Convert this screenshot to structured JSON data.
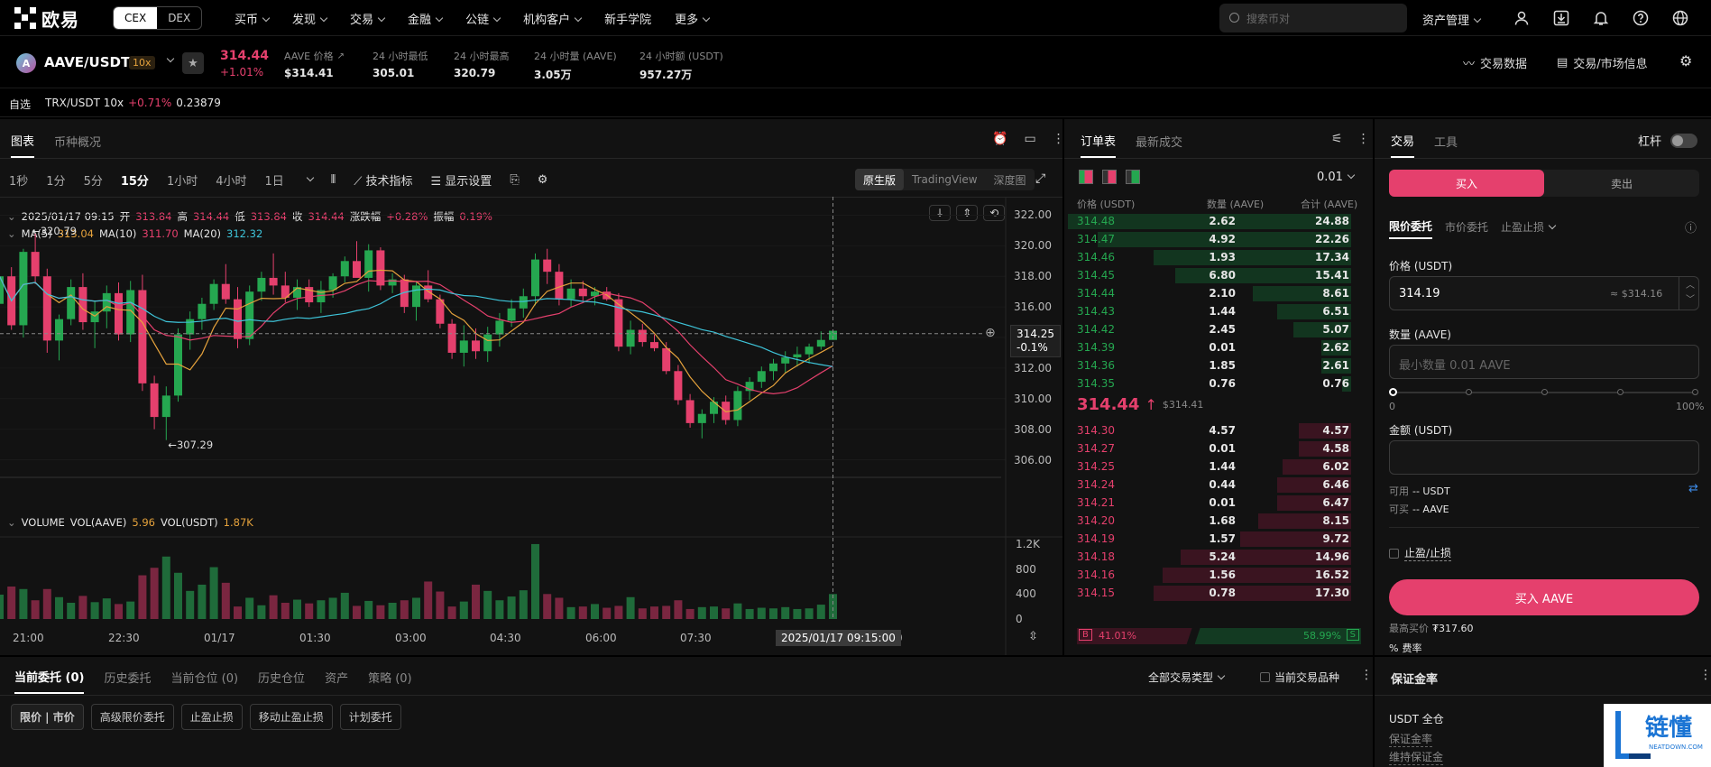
{
  "nav": {
    "brand": "欧易",
    "mode_cex": "CEX",
    "mode_dex": "DEX",
    "items": [
      "买币",
      "发现",
      "交易",
      "金融",
      "公链",
      "机构客户",
      "新手学院",
      "更多"
    ],
    "search_placeholder": "搜索币对",
    "asset_menu": "资产管理",
    "icons": [
      "user-icon",
      "download-icon",
      "bell-icon",
      "help-icon",
      "globe-icon"
    ]
  },
  "ticker": {
    "pair": "AAVE/USDT",
    "leverage": "10x",
    "price": "314.44",
    "change": "+1.01%",
    "stats": [
      {
        "label": "AAVE 价格",
        "value": "$314.41"
      },
      {
        "label": "24 小时最低",
        "value": "305.01"
      },
      {
        "label": "24 小时最高",
        "value": "320.79"
      },
      {
        "label": "24 小时量 (AAVE)",
        "value": "3.05万"
      },
      {
        "label": "24 小时额 (USDT)",
        "value": "957.27万"
      }
    ],
    "trade_data": "交易数据",
    "market_info": "交易/市场信息"
  },
  "watch": {
    "label": "自选",
    "item_pair": "TRX/USDT 10x",
    "item_change": "+0.71%",
    "item_price": "0.23879"
  },
  "chart": {
    "tab_chart": "图表",
    "tab_overview": "币种概况",
    "timeframes": [
      "1秒",
      "1分",
      "5分",
      "15分",
      "1小时",
      "4小时",
      "1日"
    ],
    "indicators": "技术指标",
    "display_settings": "显示设置",
    "modes": [
      "原生版",
      "TradingView",
      "深度图"
    ],
    "ohlc": {
      "date": "2025/01/17 09:15",
      "open_l": "开",
      "open": "313.84",
      "high_l": "高",
      "high": "314.44",
      "low_l": "低",
      "low": "313.84",
      "close_l": "收",
      "close": "314.44",
      "chg_l": "涨跌幅",
      "chg": "+0.28%",
      "amp_l": "振幅",
      "amp": "0.19%"
    },
    "ma": {
      "ma5_l": "MA(5)",
      "ma5": "313.04",
      "ma10_l": "MA(10)",
      "ma10": "311.70",
      "ma20_l": "MA(20)",
      "ma20": "312.32"
    },
    "vol": {
      "title": "VOLUME",
      "vol_aave_l": "VOL(AAVE)",
      "vol_aave": "5.96",
      "vol_usdt_l": "VOL(USDT)",
      "vol_usdt": "1.87K"
    },
    "y_ticks": [
      "322.00",
      "320.00",
      "318.00",
      "316.00",
      "314.00",
      "312.00",
      "310.00",
      "308.00",
      "306.00"
    ],
    "vol_ticks": [
      "1.2K",
      "800",
      "400",
      "0"
    ],
    "x_ticks": [
      "21:00",
      "22:30",
      "01/17",
      "01:30",
      "03:00",
      "04:30",
      "06:00",
      "07:30",
      "10:30"
    ],
    "cur_price": "314.25",
    "cur_pct": "-0.1%",
    "max_label": "320.79",
    "min_label": "307.29",
    "time_tag": "2025/01/17 09:15:00",
    "colors": {
      "up": "#25a750",
      "down": "#e5406d",
      "ma5": "#e5a23c",
      "ma10": "#e5406d",
      "ma20": "#3ec4d9"
    }
  },
  "chart_data": {
    "type": "candlestick",
    "y_range": [
      305.5,
      322.5
    ],
    "vol_range": [
      0,
      1300
    ],
    "candles": [
      [
        316.2,
        318.4,
        315.1,
        318.0
      ],
      [
        318.0,
        318.6,
        314.5,
        314.8
      ],
      [
        314.8,
        319.8,
        314.0,
        319.6
      ],
      [
        319.6,
        320.79,
        317.5,
        318.0
      ],
      [
        318.0,
        318.5,
        313.0,
        313.8
      ],
      [
        313.8,
        315.5,
        312.5,
        315.2
      ],
      [
        315.2,
        317.8,
        314.8,
        317.3
      ],
      [
        317.3,
        318.2,
        314.5,
        315.0
      ],
      [
        315.0,
        316.4,
        313.3,
        315.7
      ],
      [
        315.7,
        317.4,
        314.6,
        316.9
      ],
      [
        316.9,
        317.6,
        313.8,
        314.2
      ],
      [
        314.2,
        317.7,
        313.7,
        317.1
      ],
      [
        317.1,
        318.1,
        310.5,
        311.0
      ],
      [
        311.0,
        311.5,
        308.0,
        308.8
      ],
      [
        308.8,
        310.8,
        307.29,
        310.2
      ],
      [
        310.2,
        314.6,
        309.8,
        314.2
      ],
      [
        314.2,
        315.7,
        313.2,
        315.2
      ],
      [
        315.2,
        316.6,
        314.5,
        316.2
      ],
      [
        316.2,
        317.8,
        315.8,
        317.5
      ],
      [
        317.5,
        318.8,
        316.2,
        316.5
      ],
      [
        316.5,
        317.3,
        313.3,
        313.9
      ],
      [
        313.9,
        317.4,
        313.5,
        317.0
      ],
      [
        317.0,
        318.3,
        316.4,
        317.9
      ],
      [
        317.9,
        319.5,
        316.8,
        317.4
      ],
      [
        317.4,
        318.3,
        316.3,
        316.6
      ],
      [
        316.6,
        317.8,
        315.8,
        317.3
      ],
      [
        317.3,
        317.8,
        316.0,
        316.3
      ],
      [
        316.3,
        317.7,
        315.6,
        317.1
      ],
      [
        317.1,
        318.2,
        316.6,
        318.0
      ],
      [
        318.0,
        319.3,
        317.6,
        319.0
      ],
      [
        319.0,
        320.3,
        318.1,
        317.9
      ],
      [
        317.9,
        320.1,
        317.0,
        319.7
      ],
      [
        319.7,
        319.9,
        317.1,
        317.4
      ],
      [
        317.4,
        318.2,
        316.9,
        317.8
      ],
      [
        317.8,
        318.1,
        315.6,
        316.0
      ],
      [
        316.0,
        317.7,
        315.1,
        317.4
      ],
      [
        317.4,
        318.4,
        316.3,
        316.5
      ],
      [
        316.5,
        316.8,
        314.6,
        314.9
      ],
      [
        314.9,
        315.2,
        312.6,
        313.0
      ],
      [
        313.0,
        314.8,
        312.1,
        313.8
      ],
      [
        313.8,
        314.6,
        312.6,
        313.1
      ],
      [
        313.1,
        314.7,
        312.4,
        314.2
      ],
      [
        314.2,
        315.6,
        313.4,
        315.1
      ],
      [
        315.1,
        316.5,
        314.7,
        315.9
      ],
      [
        315.9,
        317.2,
        315.3,
        316.7
      ],
      [
        316.7,
        319.5,
        316.1,
        319.1
      ],
      [
        319.1,
        319.8,
        317.5,
        318.3
      ],
      [
        318.3,
        318.8,
        316.1,
        316.5
      ],
      [
        316.5,
        317.8,
        316.0,
        317.2
      ],
      [
        317.2,
        317.7,
        316.4,
        316.7
      ],
      [
        316.7,
        317.3,
        316.1,
        317.0
      ],
      [
        317.0,
        317.3,
        316.4,
        316.5
      ],
      [
        316.5,
        316.9,
        313.1,
        313.4
      ],
      [
        313.4,
        315.1,
        312.9,
        314.5
      ],
      [
        314.5,
        314.9,
        313.4,
        313.7
      ],
      [
        313.7,
        314.2,
        313.1,
        313.3
      ],
      [
        313.3,
        313.7,
        311.6,
        311.8
      ],
      [
        311.8,
        312.2,
        309.6,
        309.9
      ],
      [
        309.9,
        310.3,
        308.1,
        308.4
      ],
      [
        308.4,
        309.3,
        307.4,
        309.0
      ],
      [
        309.0,
        310.1,
        308.4,
        309.8
      ],
      [
        309.8,
        310.2,
        308.3,
        308.6
      ],
      [
        308.6,
        310.8,
        308.2,
        310.5
      ],
      [
        310.5,
        311.4,
        309.9,
        311.1
      ],
      [
        311.1,
        312.1,
        310.7,
        311.8
      ],
      [
        311.8,
        312.6,
        311.2,
        312.3
      ],
      [
        312.3,
        313.1,
        311.7,
        312.7
      ],
      [
        312.7,
        313.4,
        312.1,
        312.9
      ],
      [
        312.9,
        313.6,
        312.3,
        313.4
      ],
      [
        313.4,
        314.4,
        313.2,
        313.84
      ],
      [
        313.84,
        314.44,
        313.84,
        314.44
      ]
    ],
    "volumes": [
      390,
      520,
      480,
      300,
      480,
      350,
      260,
      370,
      270,
      330,
      240,
      280,
      700,
      820,
      1000,
      740,
      450,
      550,
      830,
      580,
      200,
      340,
      220,
      380,
      260,
      310,
      250,
      300,
      340,
      420,
      210,
      290,
      220,
      260,
      300,
      340,
      600,
      440,
      200,
      280,
      550,
      450,
      300,
      360,
      460,
      1200,
      400,
      340,
      190,
      200,
      240,
      180,
      210,
      350,
      170,
      200,
      210,
      300,
      160,
      190,
      200,
      170,
      250,
      160,
      180,
      170,
      190,
      160,
      170,
      230,
      400
    ],
    "ma5_approx": [],
    "x_labels": [
      "21:00",
      "22:30",
      "01/17",
      "01:30",
      "03:00",
      "04:30",
      "06:00",
      "07:30",
      "10:30"
    ]
  },
  "book": {
    "tab_book": "订单表",
    "tab_trades": "最新成交",
    "tick": "0.01",
    "cols": [
      "价格 (USDT)",
      "数量 (AAVE)",
      "合计 (AAVE)"
    ],
    "asks": [
      [
        "314.48",
        "2.62",
        "24.88"
      ],
      [
        "314.47",
        "4.92",
        "22.26"
      ],
      [
        "314.46",
        "1.93",
        "17.34"
      ],
      [
        "314.45",
        "6.80",
        "15.41"
      ],
      [
        "314.44",
        "2.10",
        "8.61"
      ],
      [
        "314.43",
        "1.44",
        "6.51"
      ],
      [
        "314.42",
        "2.45",
        "5.07"
      ],
      [
        "314.39",
        "0.01",
        "2.62"
      ],
      [
        "314.36",
        "1.85",
        "2.61"
      ],
      [
        "314.35",
        "0.76",
        "0.76"
      ]
    ],
    "mid_price": "314.44",
    "mid_index": "$314.41",
    "bids": [
      [
        "314.30",
        "4.57",
        "4.57"
      ],
      [
        "314.27",
        "0.01",
        "4.58"
      ],
      [
        "314.25",
        "1.44",
        "6.02"
      ],
      [
        "314.24",
        "0.44",
        "6.46"
      ],
      [
        "314.21",
        "0.01",
        "6.47"
      ],
      [
        "314.20",
        "1.68",
        "8.15"
      ],
      [
        "314.19",
        "1.57",
        "9.72"
      ],
      [
        "314.18",
        "5.24",
        "14.96"
      ],
      [
        "314.16",
        "1.56",
        "16.52"
      ],
      [
        "314.15",
        "0.78",
        "17.30"
      ]
    ],
    "buy_label": "B",
    "buy_pct": "41.01%",
    "sell_label": "S",
    "sell_pct": "58.99%"
  },
  "trade": {
    "tab_trade": "交易",
    "tab_tools": "工具",
    "leverage_label": "杠杆",
    "buy": "买入",
    "sell": "卖出",
    "order_types": [
      "限价委托",
      "市价委托",
      "止盈止损"
    ],
    "price_label": "价格 (USDT)",
    "price_value": "314.19",
    "price_usd": "≈ $314.16",
    "qty_label": "数量 (AAVE)",
    "qty_placeholder": "最小数量 0.01 AAVE",
    "slider_min": "0",
    "slider_max": "100%",
    "amount_label": "金额 (USDT)",
    "avail_l": "可用",
    "avail": "-- USDT",
    "canbuy_l": "可买",
    "canbuy": "-- AAVE",
    "tpsl": "止盈/止损",
    "submit": "买入 AAVE",
    "max_buy_l": "最高买价",
    "max_buy": "₮317.60",
    "fee": "费率"
  },
  "bottom": {
    "tabs": [
      "当前委托 (0)",
      "历史委托",
      "当前仓位 (0)",
      "历史仓位",
      "资产",
      "策略 (0)"
    ],
    "filter": "全部交易类型",
    "current_only": "当前交易品种",
    "sub_tabs": [
      "限价 | 市价",
      "高级限价委托",
      "止盈止损",
      "移动止盈止损",
      "计划委托"
    ]
  },
  "margin": {
    "title": "保证金率",
    "account": "USDT 全仓",
    "rate": "保证金率",
    "maint": "维持保证金"
  },
  "watermark": {
    "text": "链懂",
    "sub": "NEATDOWN.COM"
  }
}
